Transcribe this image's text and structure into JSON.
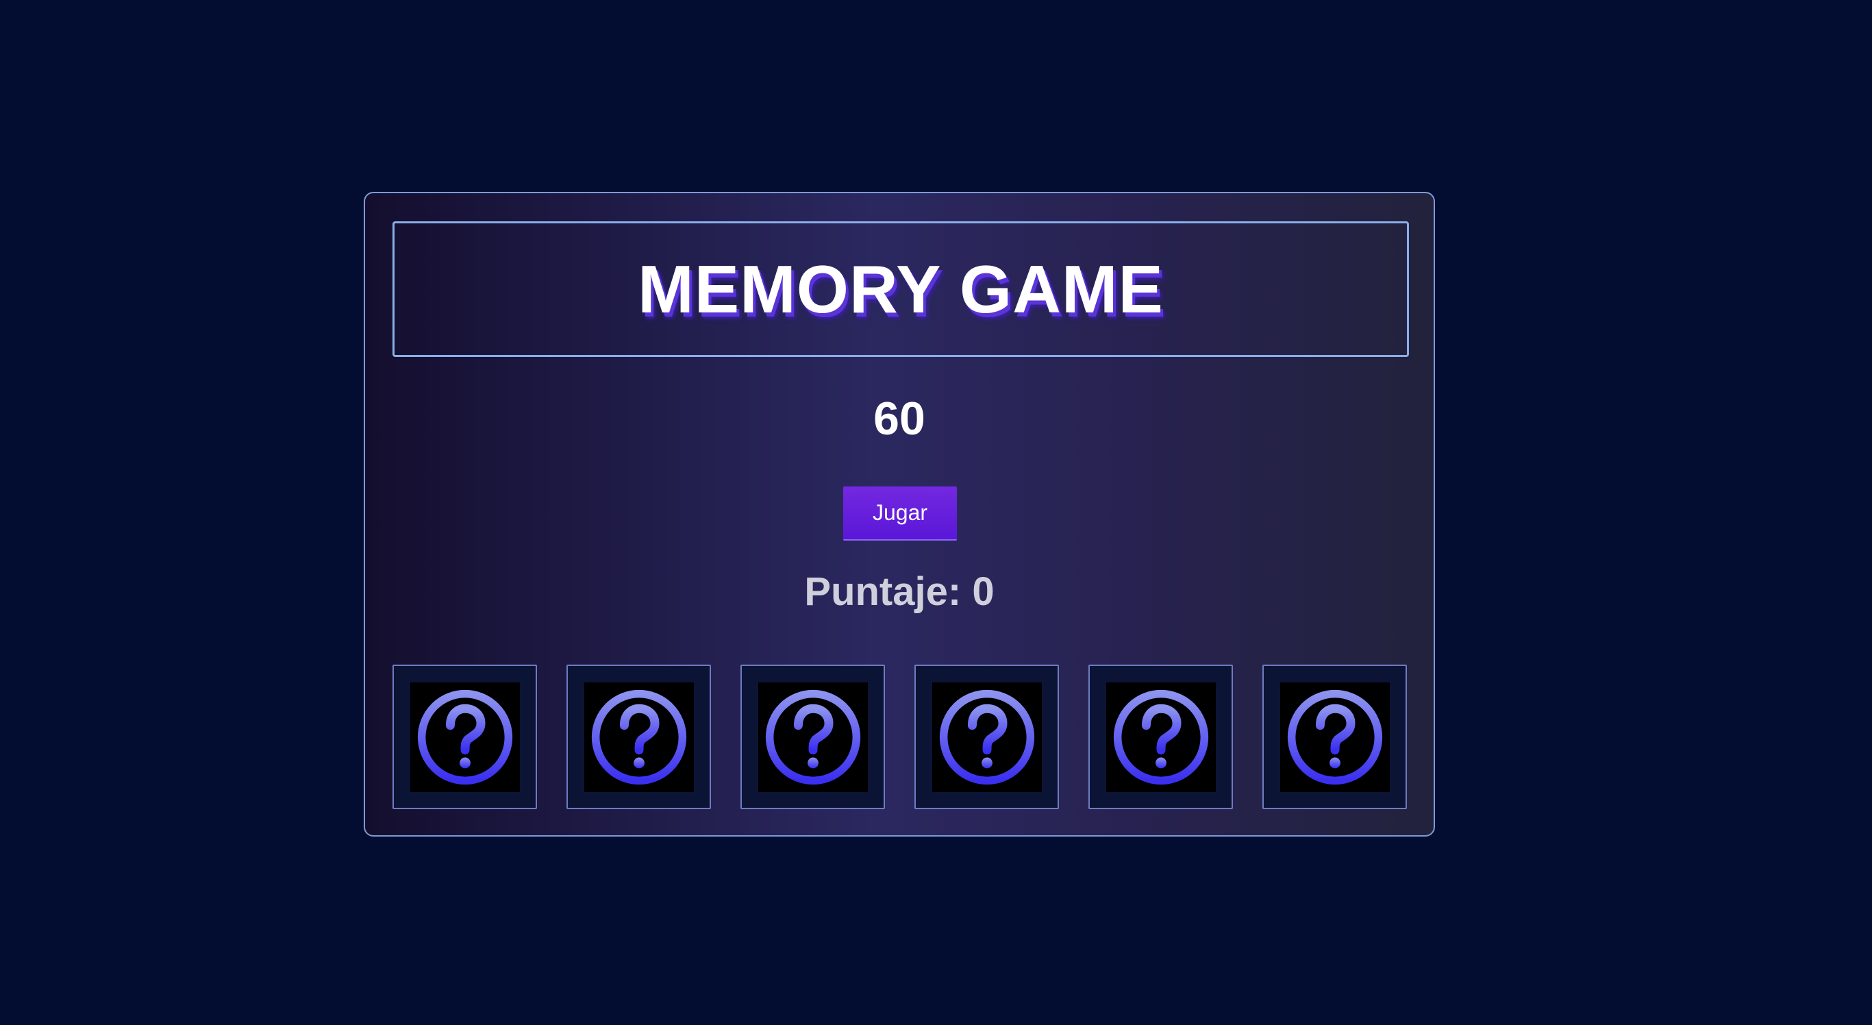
{
  "game": {
    "title": "MEMORY GAME",
    "timer": "60",
    "play_label": "Jugar",
    "score_label": "Puntaje:",
    "score_value": "0"
  },
  "cards": [
    {
      "state": "face-down",
      "icon": "question-mark-icon"
    },
    {
      "state": "face-down",
      "icon": "question-mark-icon"
    },
    {
      "state": "face-down",
      "icon": "question-mark-icon"
    },
    {
      "state": "face-down",
      "icon": "question-mark-icon"
    },
    {
      "state": "face-down",
      "icon": "question-mark-icon"
    },
    {
      "state": "face-down",
      "icon": "question-mark-icon"
    }
  ],
  "colors": {
    "background": "#030d31",
    "panel_border": "#7d9ad6",
    "button": "#5a17d8",
    "icon_gradient_top": "#8d93ef",
    "icon_gradient_bottom": "#3b2ff0"
  }
}
